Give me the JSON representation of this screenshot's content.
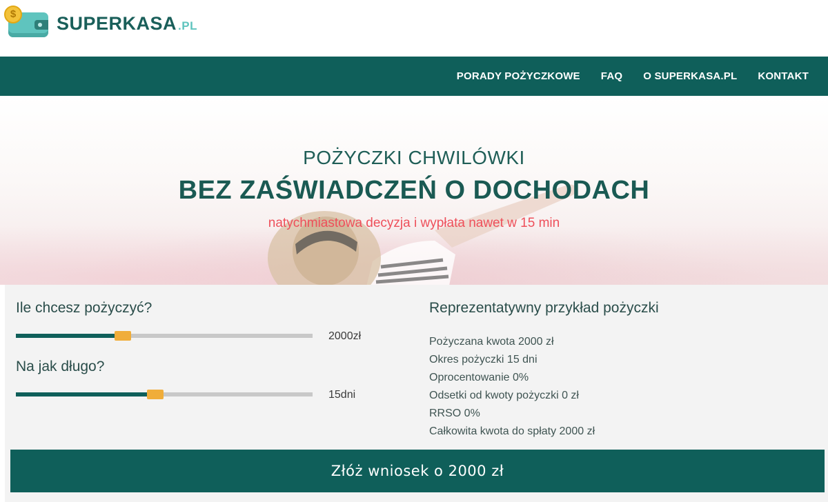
{
  "header": {
    "logo_name": "SUPERKASA",
    "logo_tld": ".PL",
    "logo_coin": "$"
  },
  "nav": {
    "items": [
      {
        "label": "PORADY POŻYCZKOWE"
      },
      {
        "label": "FAQ"
      },
      {
        "label": "O SUPERKASA.PL"
      },
      {
        "label": "KONTAKT"
      }
    ]
  },
  "hero": {
    "title_line1": "POŻYCZKI CHWILÓWKI",
    "title_line2": "BEZ ZAŚWIADCZEŃ O DOCHODACH",
    "subtitle": "natychmiastowa decyzja i wypłata nawet w 15 min"
  },
  "calculator": {
    "amount_question": "Ile chcesz pożyczyć?",
    "amount_value": "2000zł",
    "amount_fraction": 0.36,
    "period_question": "Na jak długo?",
    "period_value": "15dni",
    "period_fraction": 0.47,
    "example_title": "Reprezentatywny przykład pożyczki",
    "example_lines": [
      "Pożyczana kwota 2000 zł",
      "Okres pożyczki 15 dni",
      "Oprocentowanie 0%",
      "Odsetki od kwoty pożyczki 0 zł",
      "RRSO 0%",
      "Całkowita kwota do spłaty 2000 zł"
    ],
    "submit_label": "Złóż wniosek o 2000 zł"
  },
  "colors": {
    "brand": "#0f5f5a",
    "accent": "#f0ad3a",
    "subtitle": "#ee4f5a"
  }
}
